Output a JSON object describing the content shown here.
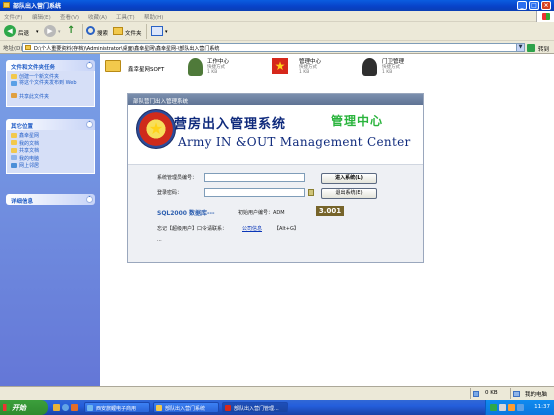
{
  "window": {
    "title": "部队出入营门系统",
    "controls": {
      "minimize": "_",
      "maximize": "□",
      "close": "×"
    }
  },
  "menu": [
    "文件(F)",
    "编辑(E)",
    "查看(V)",
    "收藏(A)",
    "工具(T)",
    "帮助(H)"
  ],
  "toolbar": {
    "back_label": "后退",
    "search_label": "搜索",
    "folders_label": "文件夹"
  },
  "address": {
    "label": "地址(D)",
    "value": "D:\\个人重要资料(存档)\\Administrator\\桌面\\鑫幸星网\\鑫幸星网-\\部队出入营门系统",
    "go_label": "转到"
  },
  "taskpane": {
    "file_tasks": {
      "title": "文件和文件夹任务",
      "items": [
        "创建一个新文件夹",
        "将这个文件夹发布到 Web",
        "共享此文件夹"
      ]
    },
    "other_places": {
      "title": "其它位置",
      "items": [
        "鑫幸星网",
        "我的文档",
        "共享文档",
        "我的电脑",
        "网上邻居"
      ]
    },
    "details": {
      "title": "详细信息"
    }
  },
  "files": [
    {
      "name": "鑫幸星网SOFT",
      "sub": ""
    },
    {
      "name": "工作中心",
      "sub": "快捷方式\n1 KB"
    },
    {
      "name": "管理中心",
      "sub": "快捷方式\n1 KB"
    },
    {
      "name": "门卫管理",
      "sub": "快捷方式\n1 KB"
    }
  ],
  "dialog": {
    "title": "部队营门出入管理系统",
    "cn_title": "营房出入管理系统",
    "cn_subtitle": "管理中心",
    "en_title": "Army IN &OUT Management Center",
    "operator_label": "系统管理员编号：",
    "password_label": "登录密码：",
    "login_button": "进入系统(L)",
    "exit_button": "退出系统(E)",
    "db_label": "SQL2000 数据库---",
    "initial_user": "初始用户编号：ADM",
    "version": "3.001",
    "forgot_text": "忘记【超级用户】口令请联系：",
    "forgot_link": "公司信息",
    "forgot_shortcut": "【Alt+G】",
    "dots": "..."
  },
  "statusbar": {
    "size": "0 KB",
    "zone": "我的电脑"
  },
  "taskbar": {
    "start_label": "开始",
    "tasks": [
      "西安旅鲤电子商用",
      "部队出入营门系统",
      "部队出入营门管理..."
    ],
    "clock": "11:37"
  }
}
